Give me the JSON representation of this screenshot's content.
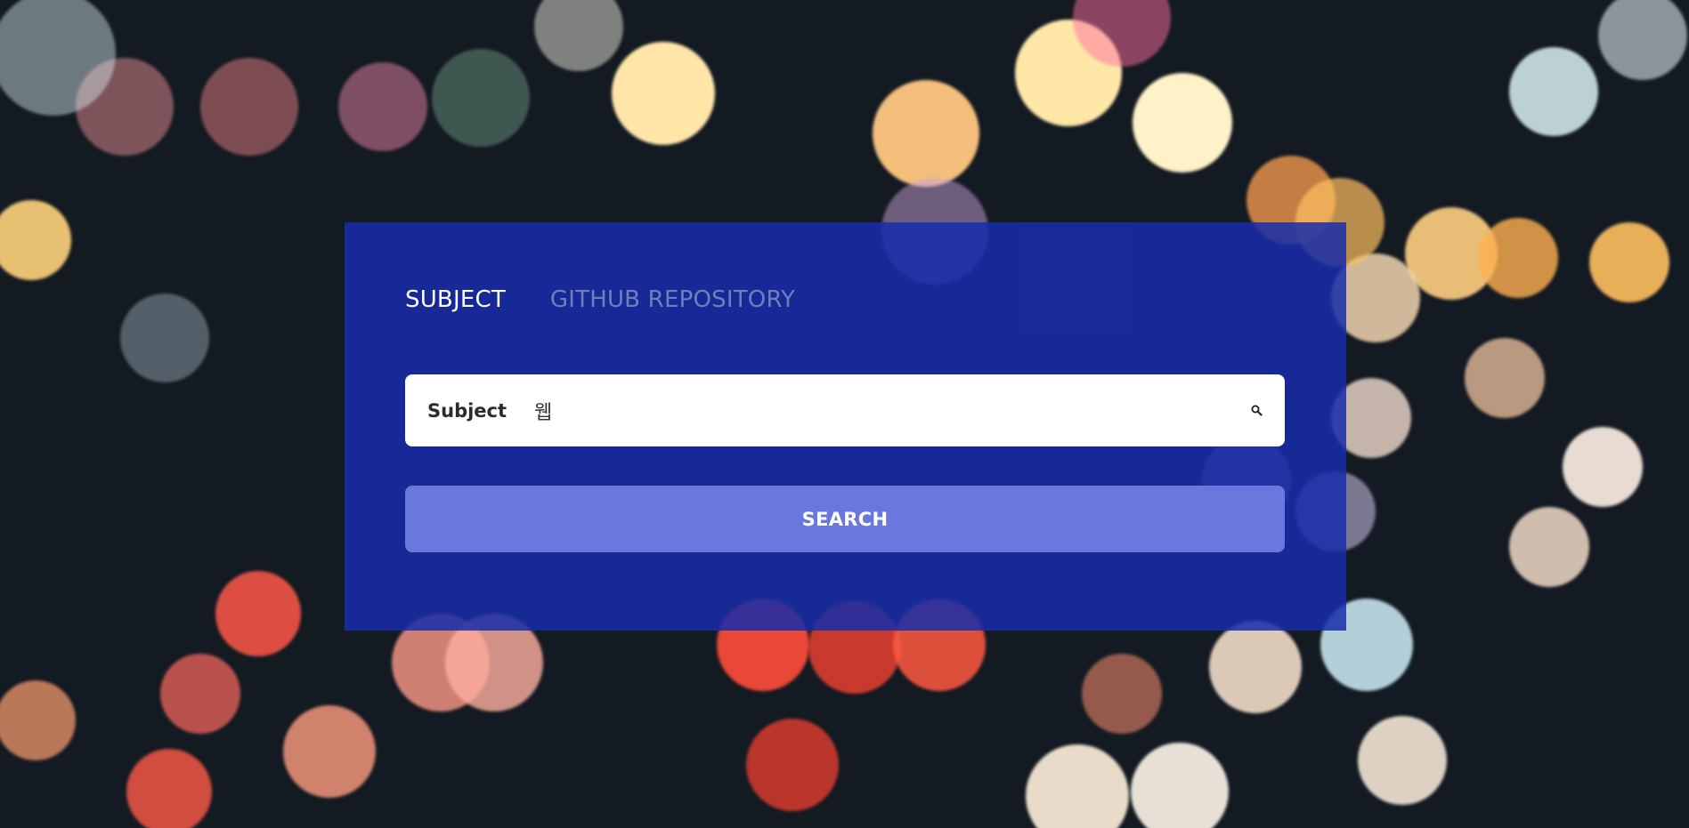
{
  "tabs": [
    {
      "label": "SUBJECT",
      "active": true
    },
    {
      "label": "GITHUB REPOSITORY",
      "active": false
    }
  ],
  "search": {
    "field_label": "Subject",
    "value": "웹",
    "icon": "search-icon"
  },
  "submit": {
    "label": "SEARCH"
  },
  "colors": {
    "panel": "#182da9",
    "button": "#6a77dd",
    "background": "#141a22"
  }
}
